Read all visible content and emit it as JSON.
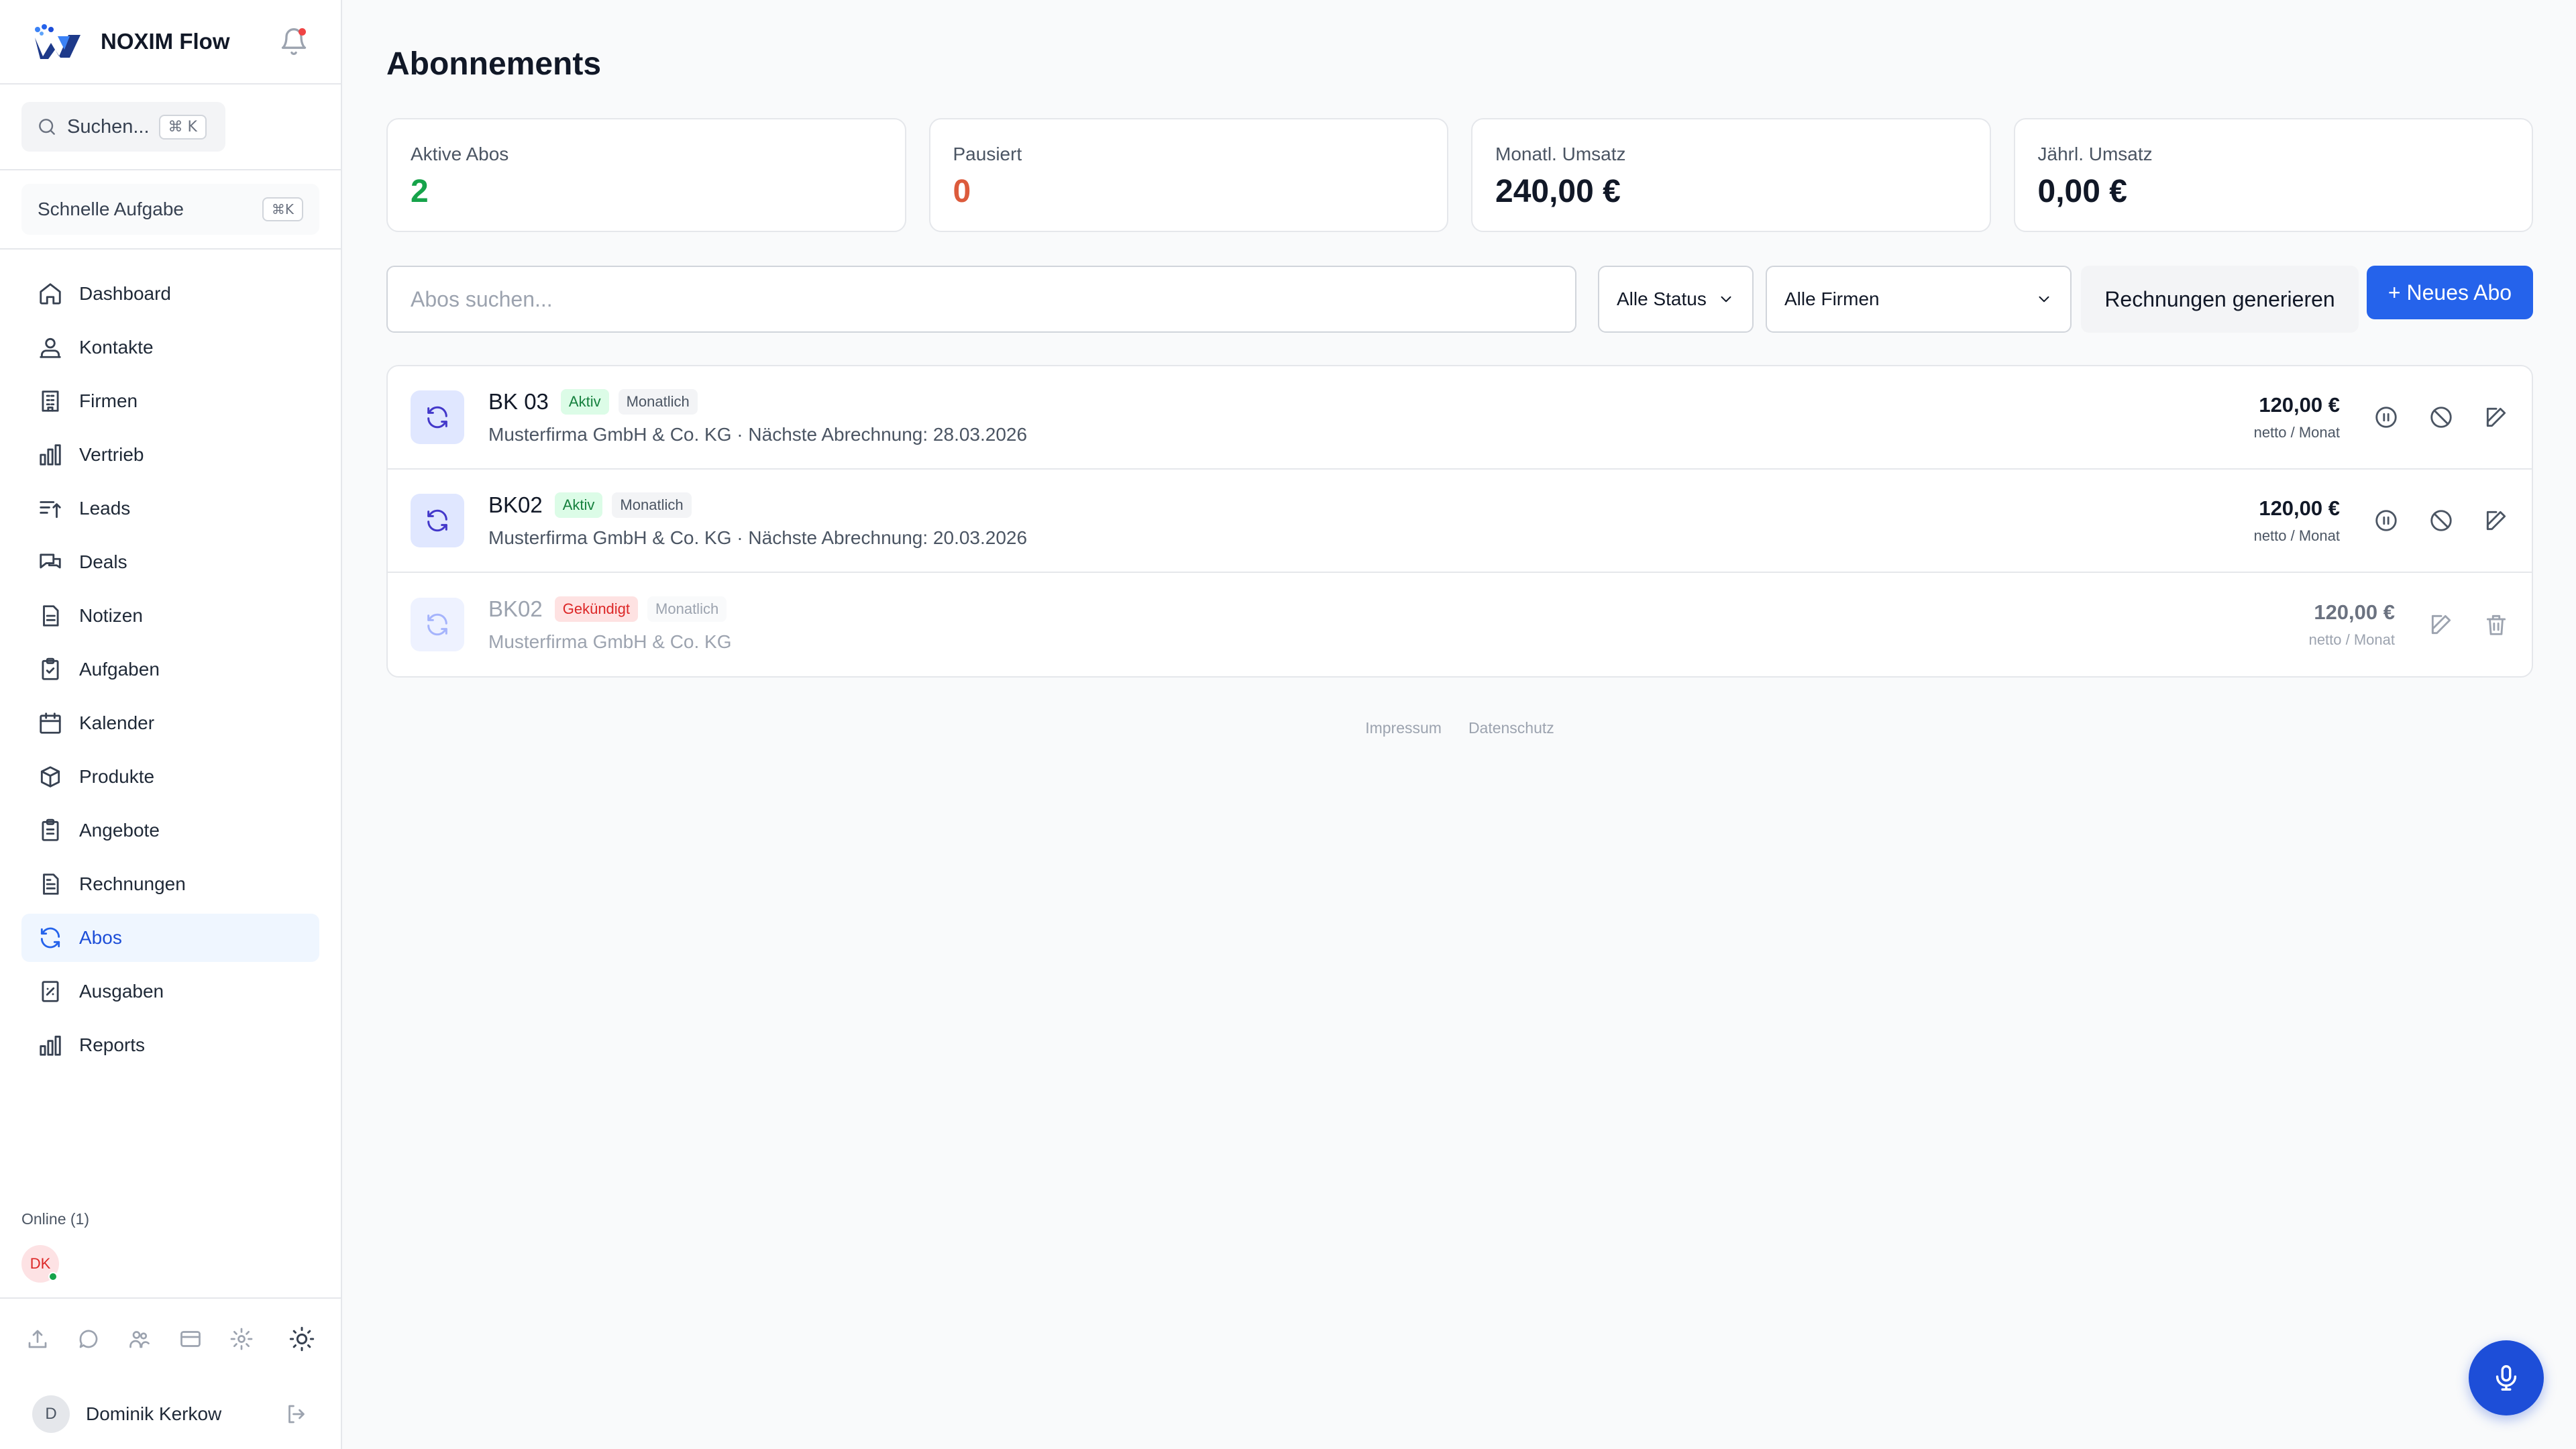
{
  "app": {
    "name": "NOXIM Flow",
    "logo": "noxim-logo"
  },
  "sidebar": {
    "search": {
      "label": "Suchen...",
      "shortcut": "⌘ K"
    },
    "quick_task": {
      "label": "Schnelle Aufgabe",
      "shortcut": "⌘K"
    },
    "items": [
      {
        "label": "Dashboard",
        "icon": "home-icon"
      },
      {
        "label": "Kontakte",
        "icon": "contacts-icon"
      },
      {
        "label": "Firmen",
        "icon": "building-icon"
      },
      {
        "label": "Vertrieb",
        "icon": "bar-chart-icon"
      },
      {
        "label": "Leads",
        "icon": "leads-icon"
      },
      {
        "label": "Deals",
        "icon": "chat-icon"
      },
      {
        "label": "Notizen",
        "icon": "note-icon"
      },
      {
        "label": "Aufgaben",
        "icon": "clipboard-check-icon"
      },
      {
        "label": "Kalender",
        "icon": "calendar-icon"
      },
      {
        "label": "Produkte",
        "icon": "box-icon"
      },
      {
        "label": "Angebote",
        "icon": "clipboard-list-icon"
      },
      {
        "label": "Rechnungen",
        "icon": "invoice-icon"
      },
      {
        "label": "Abos",
        "icon": "refresh-icon",
        "active": true
      },
      {
        "label": "Ausgaben",
        "icon": "receipt-icon"
      },
      {
        "label": "Reports",
        "icon": "reports-icon"
      }
    ],
    "online": {
      "label": "Online (1)",
      "users": [
        "DK"
      ]
    },
    "user": {
      "initial": "D",
      "name": "Dominik Kerkow"
    }
  },
  "page": {
    "title": "Abonnements"
  },
  "stats": [
    {
      "label": "Aktive Abos",
      "value": "2",
      "color": "#16a34a"
    },
    {
      "label": "Pausiert",
      "value": "0",
      "color": "#dc5b3c"
    },
    {
      "label": "Monatl. Umsatz",
      "value": "240,00 €",
      "color": "#111827"
    },
    {
      "label": "Jährl. Umsatz",
      "value": "0,00 €",
      "color": "#111827"
    }
  ],
  "toolbar": {
    "search_placeholder": "Abos suchen...",
    "status_filter": "Alle Status",
    "company_filter": "Alle Firmen",
    "generate_label": "Rechnungen generieren",
    "new_label": "+ Neues Abo"
  },
  "subscriptions": [
    {
      "name": "BK 03",
      "status": "Aktiv",
      "interval": "Monatlich",
      "company": "Musterfirma GmbH & Co. KG",
      "next_billing": "Nächste Abrechnung: 28.03.2026",
      "price": "120,00 €",
      "unit": "netto / Monat"
    },
    {
      "name": "BK02",
      "status": "Aktiv",
      "interval": "Monatlich",
      "company": "Musterfirma GmbH & Co. KG",
      "next_billing": "Nächste Abrechnung: 20.03.2026",
      "price": "120,00 €",
      "unit": "netto / Monat"
    },
    {
      "name": "BK02",
      "status": "Gekündigt",
      "interval": "Monatlich",
      "company": "Musterfirma GmbH & Co. KG",
      "next_billing": "",
      "price": "120,00 €",
      "unit": "netto / Monat"
    }
  ],
  "footer": {
    "impressum": "Impressum",
    "datenschutz": "Datenschutz"
  },
  "colors": {
    "accent": "#2563eb",
    "active_nav_bg": "#eff6ff",
    "success": "#16a34a",
    "danger": "#dc2626"
  }
}
